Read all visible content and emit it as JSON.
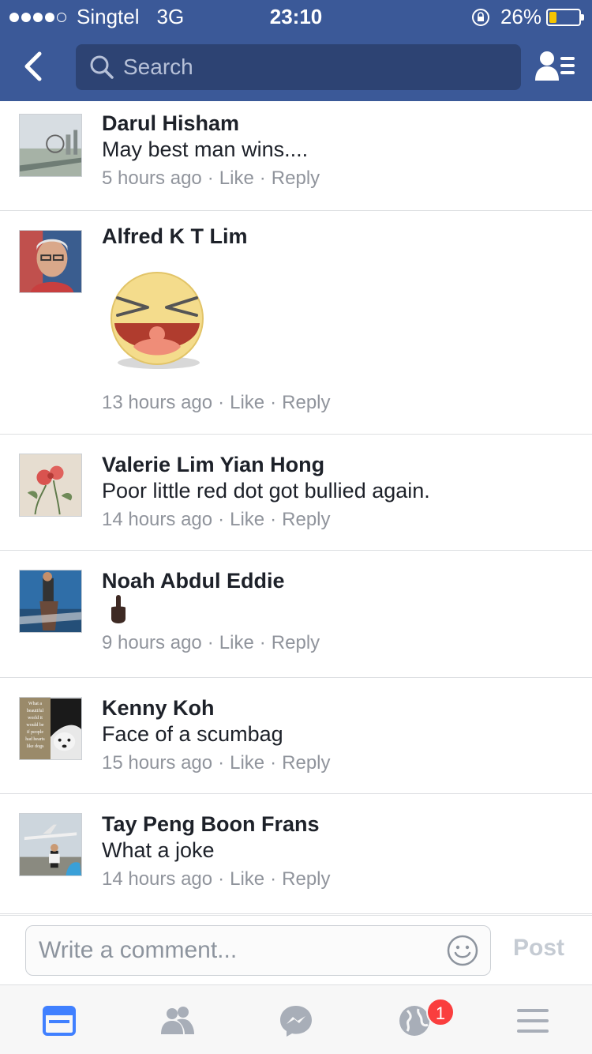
{
  "status_bar": {
    "carrier": "Singtel",
    "network": "3G",
    "time": "23:10",
    "battery_percent": "26%",
    "battery_level": 0.26
  },
  "nav": {
    "search_placeholder": "Search"
  },
  "comments": [
    {
      "author": "Darul Hisham",
      "text": "May best man wins....",
      "time": "5 hours ago",
      "like": "Like",
      "reply": "Reply"
    },
    {
      "author": "Alfred K T Lim",
      "text": "",
      "time": "13 hours ago",
      "like": "Like",
      "reply": "Reply",
      "attachment": "laughing-sticker"
    },
    {
      "author": "Valerie Lim Yian Hong",
      "text": "Poor little red dot got bullied again.",
      "time": "14 hours ago",
      "like": "Like",
      "reply": "Reply"
    },
    {
      "author": "Noah Abdul Eddie",
      "text": "",
      "time": "9 hours ago",
      "like": "Like",
      "reply": "Reply",
      "attachment": "middle-finger-emoji"
    },
    {
      "author": "Kenny Koh",
      "text": "Face of a scumbag",
      "time": "15 hours ago",
      "like": "Like",
      "reply": "Reply"
    },
    {
      "author": "Tay Peng Boon Frans",
      "text": "What a joke",
      "time": "14 hours ago",
      "like": "Like",
      "reply": "Reply"
    }
  ],
  "avatar_quote": [
    "What a",
    "beautiful",
    "world it",
    "would be",
    "if people",
    "had hearts",
    "like dogs"
  ],
  "composer": {
    "placeholder": "Write a comment...",
    "post_label": "Post"
  },
  "tab_bar": {
    "notifications_badge": "1"
  },
  "colors": {
    "brand": "#3b5998",
    "badge": "#fa3e3e",
    "meta": "#90949c",
    "active_tab": "#4080ff"
  }
}
